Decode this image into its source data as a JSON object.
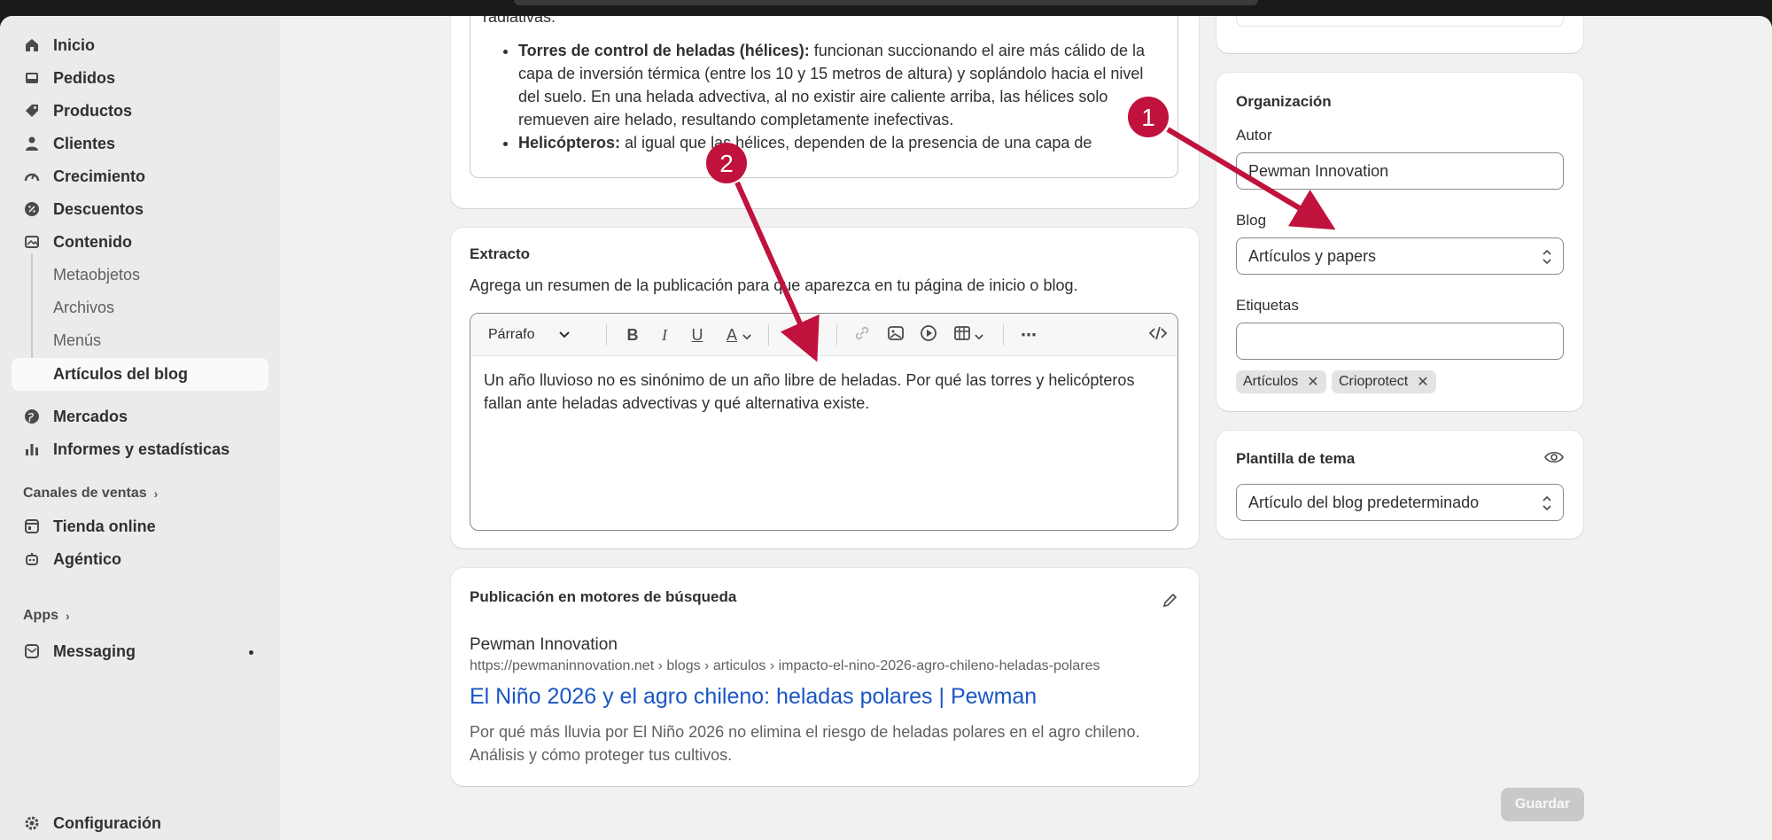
{
  "sidebar": {
    "items": [
      {
        "label": "Inicio",
        "icon": "home-icon"
      },
      {
        "label": "Pedidos",
        "icon": "inbox-icon"
      },
      {
        "label": "Productos",
        "icon": "tag-icon"
      },
      {
        "label": "Clientes",
        "icon": "person-icon"
      },
      {
        "label": "Crecimiento",
        "icon": "gauge-icon"
      },
      {
        "label": "Descuentos",
        "icon": "discount-icon"
      },
      {
        "label": "Contenido",
        "icon": "image-icon"
      }
    ],
    "content_sub": [
      "Metaobjetos",
      "Archivos",
      "Menús",
      "Artículos del blog"
    ],
    "items2": [
      {
        "label": "Mercados",
        "icon": "globe-icon"
      },
      {
        "label": "Informes y estadísticas",
        "icon": "bar-chart-icon"
      }
    ],
    "sales_channels_label": "Canales de ventas",
    "channels": [
      {
        "label": "Tienda online",
        "icon": "store-icon"
      },
      {
        "label": "Agéntico",
        "icon": "robot-icon"
      }
    ],
    "apps_label": "Apps",
    "messaging": "Messaging",
    "settings": "Configuración"
  },
  "content_card": {
    "intro": "radiativas:",
    "bullet1_bold": "Torres de control de heladas (hélices):",
    "bullet1_text": " funcionan succionando el aire más cálido de la capa de inversión térmica (entre los 10 y 15 metros de altura) y soplándolo hacia el nivel del suelo. En una helada advectiva, al no existir aire caliente arriba, las hélices solo remueven aire helado, resultando completamente inefectivas.",
    "bullet2_bold": "Helicópteros:",
    "bullet2_text": " al igual que las hélices, dependen de la presencia de una capa de"
  },
  "excerpt": {
    "title": "Extracto",
    "description": "Agrega un resumen de la publicación para que aparezca en tu página de inicio o blog.",
    "format": "Párrafo",
    "text": "Un año lluvioso no es sinónimo de un año libre de heladas. Por qué las torres y helicópteros fallan ante heladas advectivas y qué alternativa existe."
  },
  "seo": {
    "title": "Publicación en motores de búsqueda",
    "site": "Pewman Innovation",
    "url": "https://pewmaninnovation.net › blogs › articulos › impacto-el-nino-2026-agro-chileno-heladas-polares",
    "page_title": "El Niño 2026 y el agro chileno: heladas polares | Pewman",
    "description": "Por qué más lluvia por El Niño 2026 no elimina el riesgo de heladas polares en el agro chileno. Análisis y cómo proteger tus cultivos."
  },
  "organization": {
    "title": "Organización",
    "author_label": "Autor",
    "author_value": "Pewman Innovation",
    "blog_label": "Blog",
    "blog_value": "Artículos y papers",
    "tags_label": "Etiquetas",
    "tags": [
      "Artículos",
      "Crioprotect"
    ]
  },
  "theme": {
    "title": "Plantilla de tema",
    "value": "Artículo del blog predeterminado"
  },
  "save_label": "Guardar",
  "annotations": {
    "marker1": "1",
    "marker2": "2",
    "color": "#c0123c"
  }
}
